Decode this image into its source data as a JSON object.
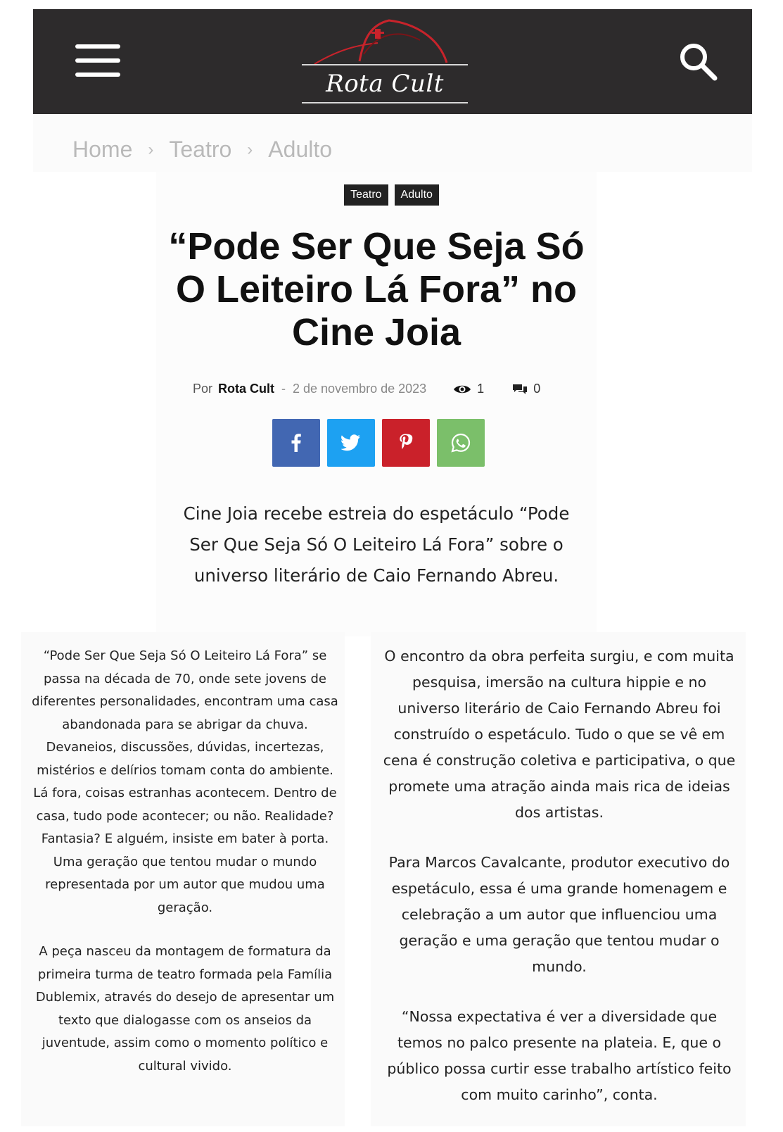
{
  "header": {
    "logo_text": "Rota Cult",
    "menu_icon": "hamburger-menu-icon",
    "search_icon": "search-icon",
    "background": "#2d2b2c",
    "logo_accent": "#c8232b"
  },
  "breadcrumb": {
    "items": [
      "Home",
      "Teatro",
      "Adulto"
    ],
    "separator": "›"
  },
  "tags": [
    "Teatro",
    "Adulto"
  ],
  "article": {
    "title": "“Pode Ser Que Seja Só O Leiteiro Lá Fora” no Cine Joia",
    "meta": {
      "by_label": "Por",
      "author": "Rota Cult",
      "dash": "-",
      "date": "2 de novembro de 2023",
      "views": "1",
      "comments": "0"
    },
    "share": [
      {
        "name": "facebook",
        "color": "#4267b2"
      },
      {
        "name": "twitter",
        "color": "#1da1f2"
      },
      {
        "name": "pinterest",
        "color": "#ca212a"
      },
      {
        "name": "whatsapp",
        "color": "#7bbf6a"
      }
    ],
    "lead": "Cine Joia recebe estreia do espetáculo “Pode Ser Que Seja Só O Leiteiro Lá Fora” sobre o universo literário de Caio Fernando Abreu.",
    "left_column": [
      "“Pode Ser Que Seja Só O Leiteiro Lá Fora” se passa na década de 70, onde sete jovens de diferentes personalidades, encontram uma casa abandonada para se abrigar da chuva. Devaneios, discussões, dúvidas, incertezas, mistérios e delírios tomam conta do ambiente. Lá fora, coisas estranhas acontecem. Dentro de casa, tudo pode acontecer; ou não. Realidade? Fantasia? E alguém, insiste em bater à porta. Uma geração que tentou mudar o mundo representada por um autor que mudou uma geração.",
      "A peça nasceu da montagem de formatura da primeira turma de teatro formada pela Família Dublemix, através do desejo de apresentar um texto que dialogasse com os anseios da juventude, assim como o momento político e cultural vivido."
    ],
    "right_column": [
      "O encontro da obra perfeita surgiu, e com muita pesquisa, imersão na cultura hippie e no universo literário de Caio Fernando Abreu foi construído o espetáculo. Tudo o que se vê em cena é construção coletiva e participativa, o que promete uma atração ainda mais rica de ideias dos artistas.",
      "Para Marcos Cavalcante, produtor executivo do espetáculo, essa é uma grande homenagem e celebração a um autor que influenciou uma geração e uma geração que tentou mudar o mundo.",
      "“Nossa expectativa é ver a diversidade que temos no palco presente na plateia. E, que o público possa curtir esse trabalho artístico feito com muito carinho”, conta."
    ]
  }
}
